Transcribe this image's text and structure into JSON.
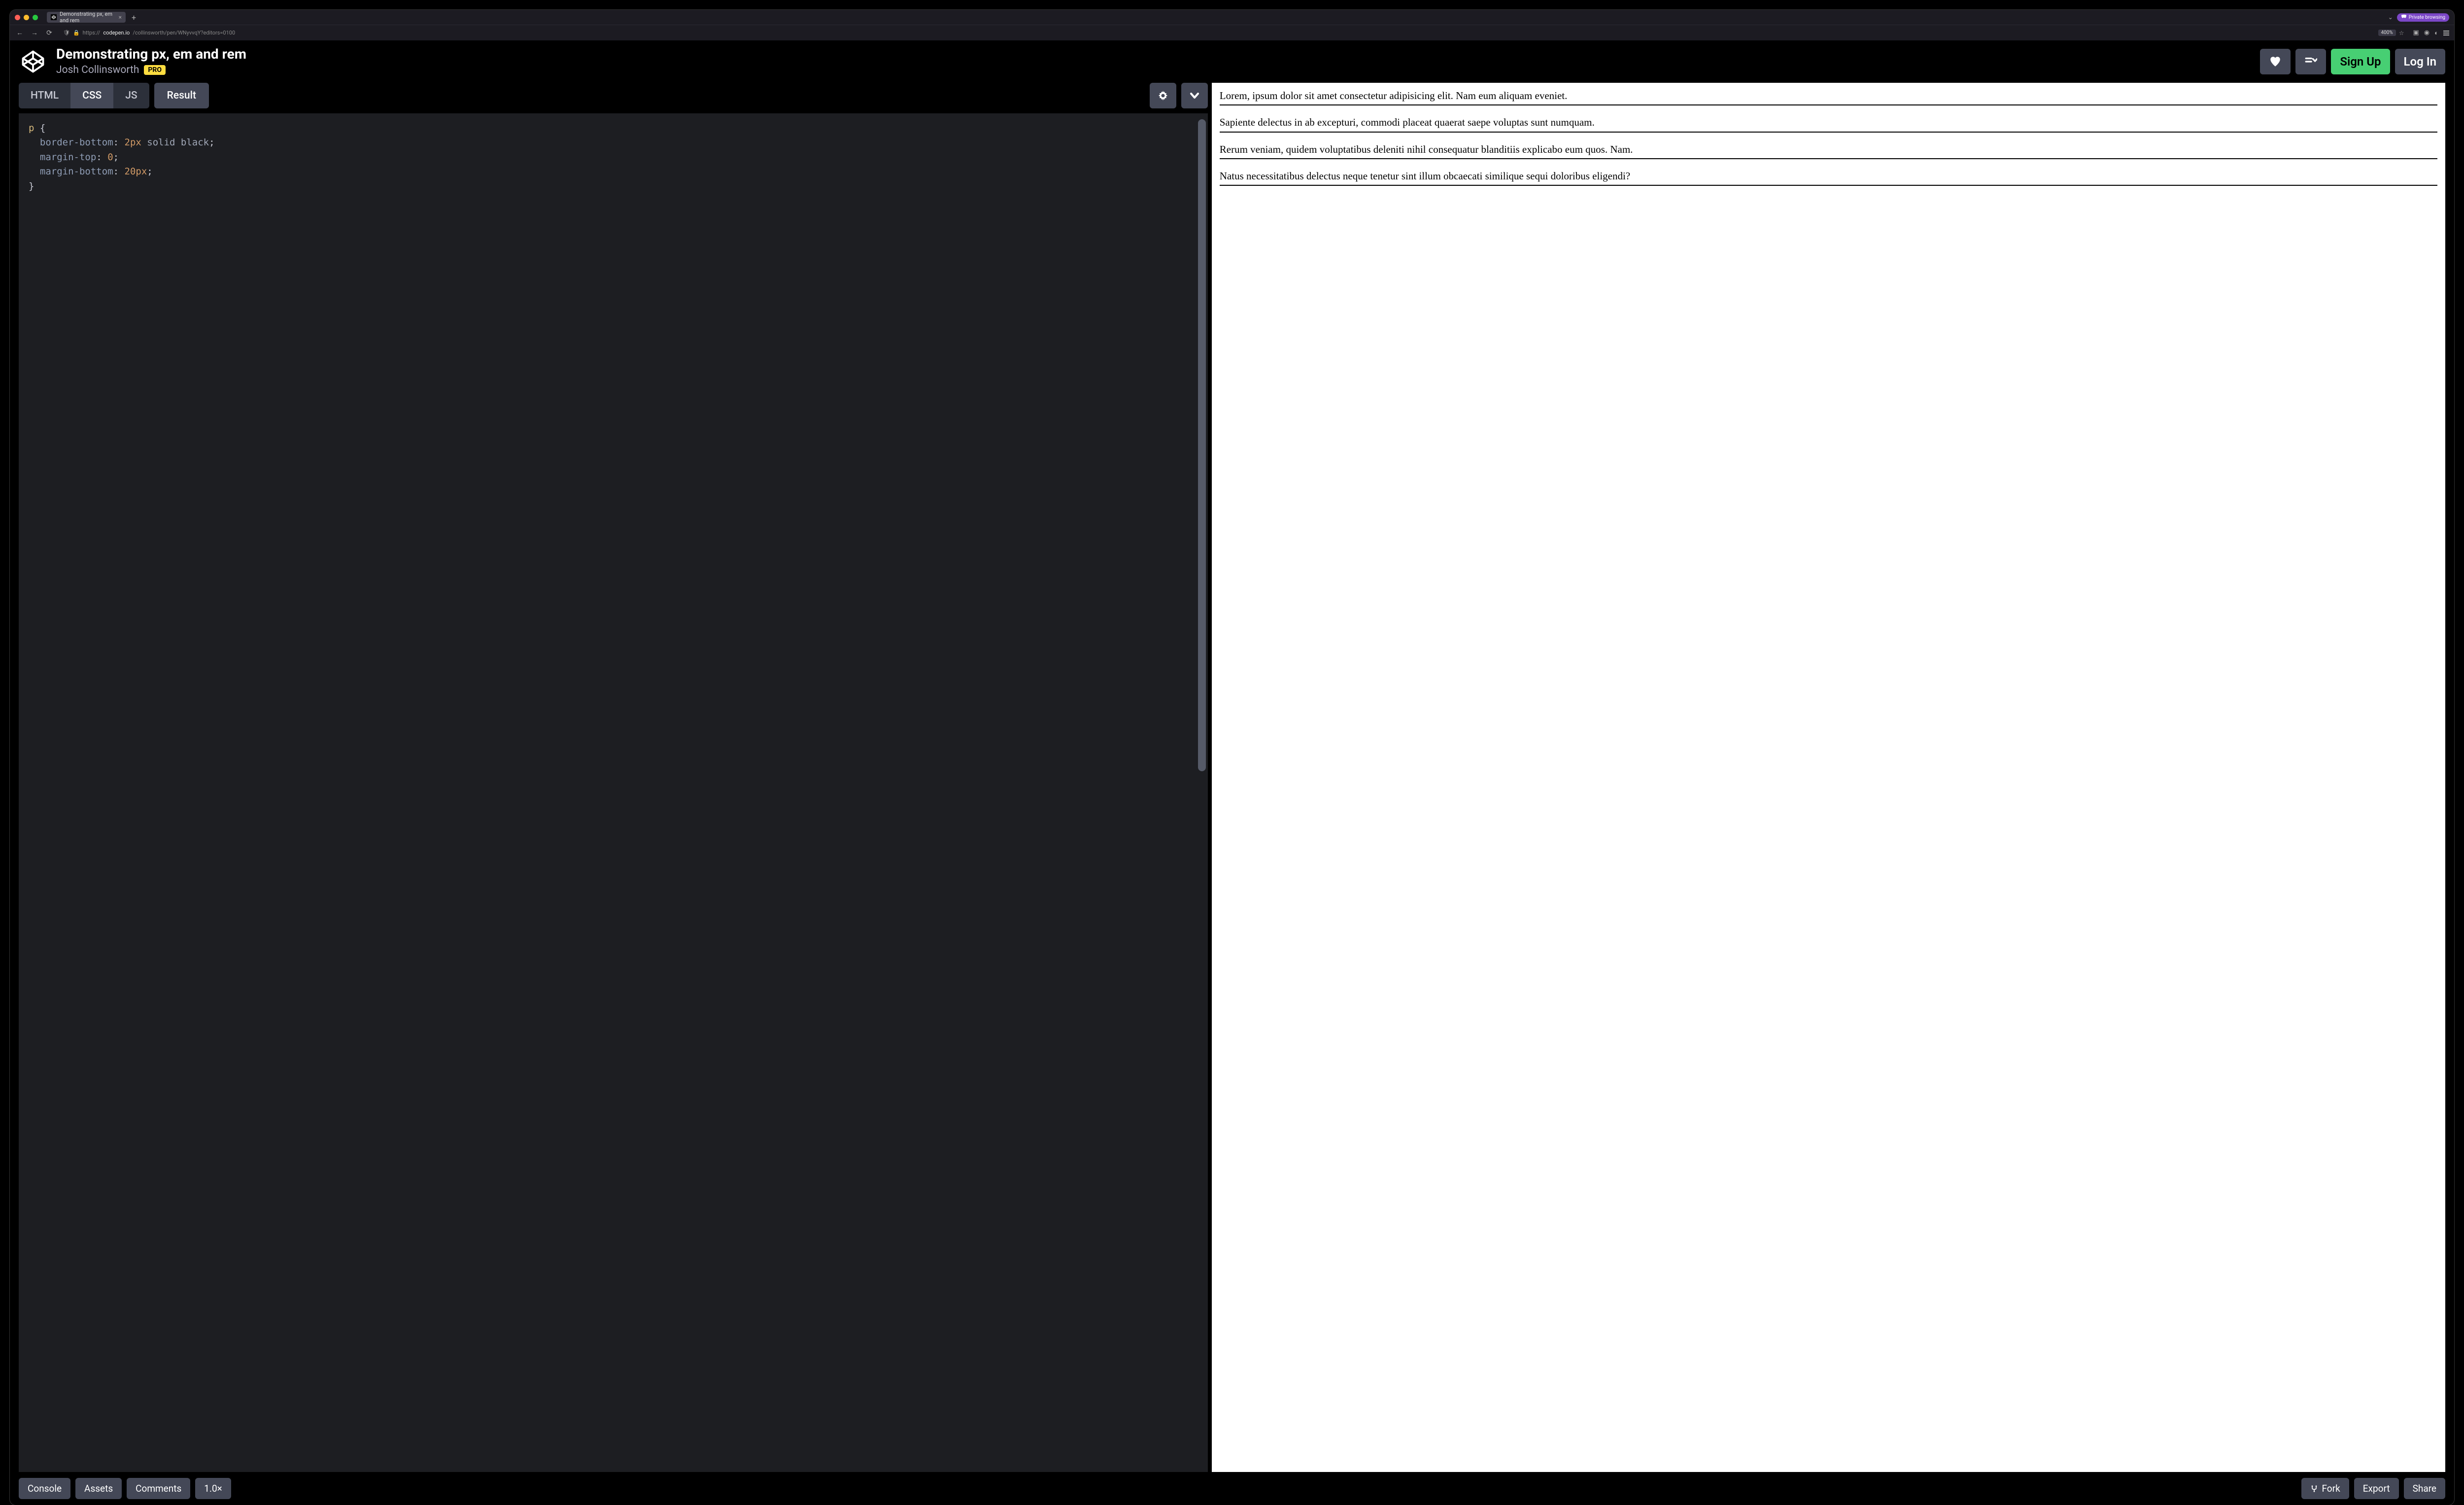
{
  "browser": {
    "tab_title": "Demonstrating px, em and rem",
    "new_tab": "+",
    "private_label": "Private browsing",
    "url_scheme": "https://",
    "url_domain": "codepen.io",
    "url_path": "/collinsworth/pen/WNyvvqY?editors=0100",
    "zoom": "400%"
  },
  "header": {
    "title": "Demonstrating px, em and rem",
    "author": "Josh Collinsworth",
    "pro_badge": "PRO",
    "signup": "Sign Up",
    "login": "Log In"
  },
  "tabs": {
    "html": "HTML",
    "css": "CSS",
    "js": "JS",
    "result": "Result"
  },
  "code": {
    "line1_sel": "p",
    "line1_brace": " {",
    "line2_prop": "border-bottom",
    "line2_val_num": "2px",
    "line2_val_kw": "solid black",
    "line3_prop": "margin-top",
    "line3_val": "0",
    "line4_prop": "margin-bottom",
    "line4_val": "20px",
    "line5_brace": "}"
  },
  "preview": {
    "p1": "Lorem, ipsum dolor sit amet consectetur adipisicing elit. Nam eum aliquam eveniet.",
    "p2": "Sapiente delectus in ab excepturi, commodi placeat quaerat saepe voluptas sunt numquam.",
    "p3": "Rerum veniam, quidem voluptatibus deleniti nihil consequatur blanditiis explicabo eum quos. Nam.",
    "p4": "Natus necessitatibus delectus neque tenetur sint illum obcaecati similique sequi doloribus eligendi?"
  },
  "footer": {
    "console": "Console",
    "assets": "Assets",
    "comments": "Comments",
    "zoom": "1.0×",
    "fork": "Fork",
    "export": "Export",
    "share": "Share"
  }
}
